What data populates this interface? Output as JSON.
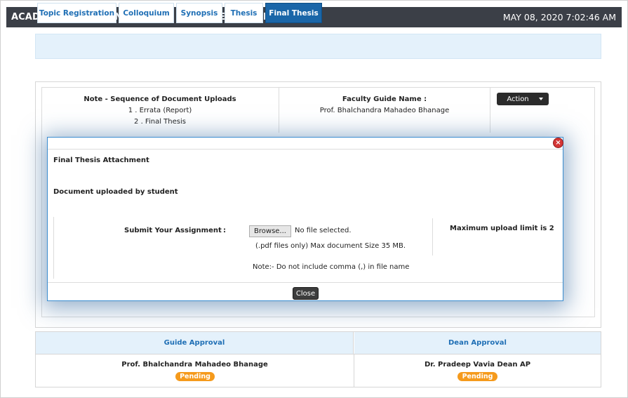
{
  "header": {
    "title": "ACADEMIC FUNCTIONS » HOME PAPER/SEMINAR/PROJECT",
    "datetime": "MAY 08, 2020  7:02:46 AM"
  },
  "tabs": [
    {
      "label": "Topic Registration",
      "active": false
    },
    {
      "label": "Colloquium",
      "active": false
    },
    {
      "label": "Synopsis",
      "active": false
    },
    {
      "label": "Thesis",
      "active": false
    },
    {
      "label": "Final Thesis",
      "active": true
    }
  ],
  "note": {
    "title": "Note - Sequence of Document Uploads",
    "items": [
      "1 . Errata (Report)",
      "2 . Final Thesis"
    ]
  },
  "faculty_guide": {
    "label": "Faculty Guide Name  :",
    "name": "Prof. Bhalchandra Mahadeo Bhanage"
  },
  "action_button": {
    "label": "Action"
  },
  "modal": {
    "heading": "Final Thesis Attachment",
    "subheading": "Document uploaded by student",
    "submit_label": "Submit Your Assignment",
    "colon": ":",
    "browse_label": "Browse...",
    "no_file_text": "No file selected.",
    "pdf_note": "(.pdf files only) Max document Size 35 MB.",
    "max_upload": "Maximum upload limit is 2",
    "comma_note": "Note:- Do not include comma (,) in file name",
    "close_label": "Close",
    "close_icon": "×"
  },
  "approvals": {
    "guide": {
      "header": "Guide Approval",
      "name": "Prof. Bhalchandra Mahadeo Bhanage",
      "status": "Pending"
    },
    "dean": {
      "header": "Dean Approval",
      "name": "Dr. Pradeep Vavia Dean AP",
      "status": "Pending"
    }
  },
  "colors": {
    "titlebar": "#3b3f47",
    "accent": "#1a66a8",
    "tabbar_bg": "#e4f1fb",
    "pending": "#f59a1c",
    "close_icon": "#d43535"
  }
}
